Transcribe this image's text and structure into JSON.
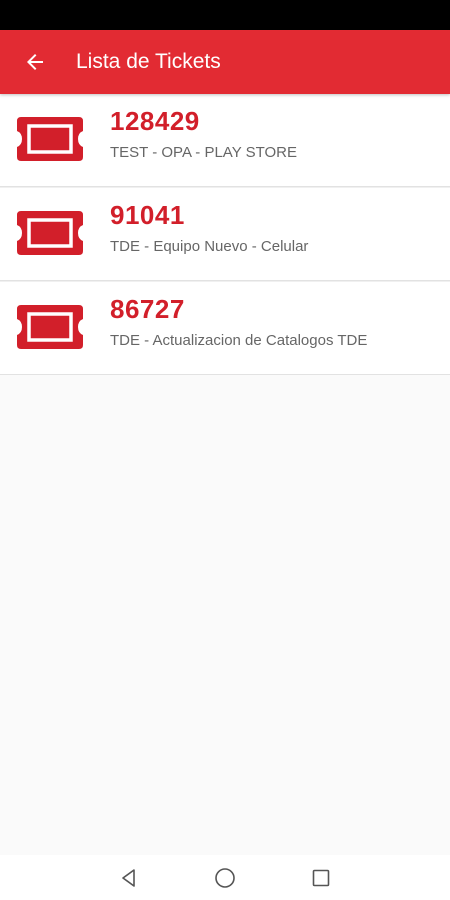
{
  "app_bar": {
    "title": "Lista de Tickets",
    "color": "#e22b33"
  },
  "icons": {
    "back": "arrow-left-icon",
    "ticket": "ticket-icon",
    "nav_back": "triangle-back-icon",
    "nav_home": "circle-home-icon",
    "nav_recents": "square-recents-icon"
  },
  "tickets": [
    {
      "number": "128429",
      "description": "TEST - OPA - PLAY STORE"
    },
    {
      "number": "91041",
      "description": "TDE - Equipo Nuevo - Celular"
    },
    {
      "number": "86727",
      "description": "TDE - Actualizacion de Catalogos TDE"
    }
  ],
  "colors": {
    "accent": "#d21f2a",
    "secondary_text": "#666666"
  }
}
